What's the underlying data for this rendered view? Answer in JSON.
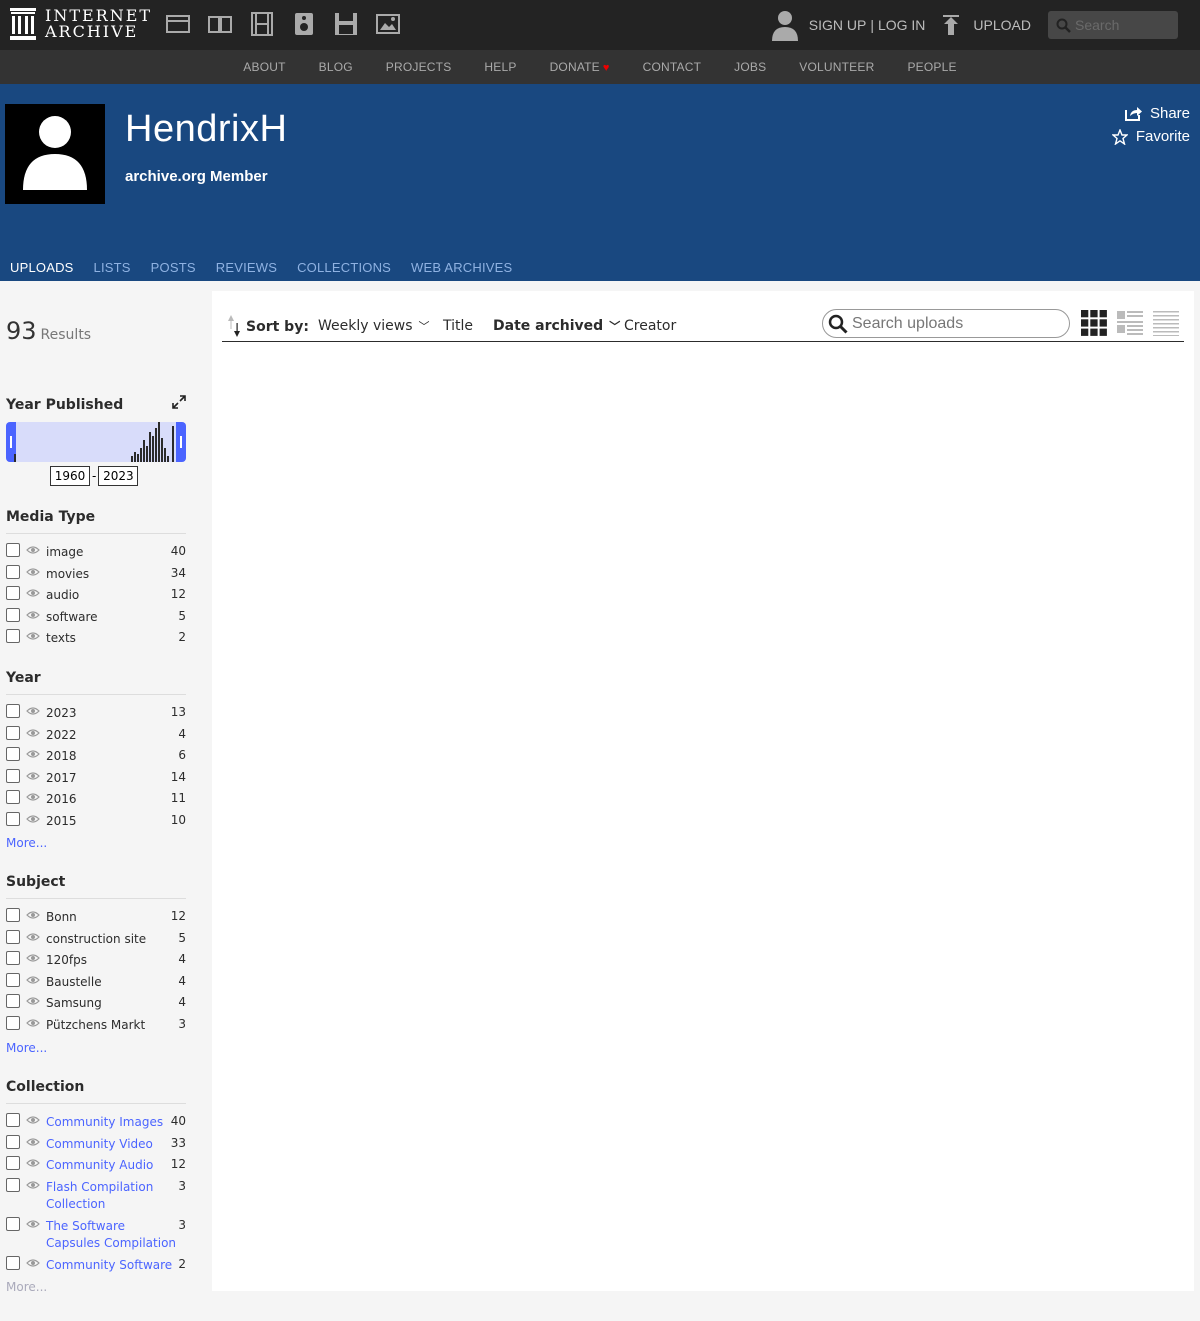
{
  "topnav": {
    "logo_line1": "INTERNET",
    "logo_line2": "ARCHIVE",
    "media_icons": [
      "web-icon",
      "texts-icon",
      "video-icon",
      "audio-icon",
      "software-icon",
      "images-icon"
    ],
    "signup": "SIGN UP",
    "separator": "|",
    "login": "LOG IN",
    "upload": "UPLOAD",
    "search_placeholder": "Search"
  },
  "subnav": {
    "items": [
      "ABOUT",
      "BLOG",
      "PROJECTS",
      "HELP",
      "DONATE",
      "CONTACT",
      "JOBS",
      "VOLUNTEER",
      "PEOPLE"
    ]
  },
  "banner": {
    "name": "HendrixH",
    "role": "archive.org Member",
    "share": "Share",
    "favorite": "Favorite",
    "tabs": [
      "UPLOADS",
      "LISTS",
      "POSTS",
      "REVIEWS",
      "COLLECTIONS",
      "WEB ARCHIVES"
    ],
    "active_tab": "UPLOADS"
  },
  "sidebar": {
    "results_count": "93",
    "results_label": "Results",
    "year_published": {
      "title": "Year Published",
      "from": "1960",
      "to": "2023"
    },
    "media_type": {
      "title": "Media Type",
      "items": [
        {
          "label": "image",
          "count": "40"
        },
        {
          "label": "movies",
          "count": "34"
        },
        {
          "label": "audio",
          "count": "12"
        },
        {
          "label": "software",
          "count": "5"
        },
        {
          "label": "texts",
          "count": "2"
        }
      ]
    },
    "year": {
      "title": "Year",
      "items": [
        {
          "label": "2023",
          "count": "13"
        },
        {
          "label": "2022",
          "count": "4"
        },
        {
          "label": "2018",
          "count": "6"
        },
        {
          "label": "2017",
          "count": "14"
        },
        {
          "label": "2016",
          "count": "11"
        },
        {
          "label": "2015",
          "count": "10"
        }
      ],
      "more": "More..."
    },
    "subject": {
      "title": "Subject",
      "items": [
        {
          "label": "Bonn",
          "count": "12"
        },
        {
          "label": "construction site",
          "count": "5"
        },
        {
          "label": "120fps",
          "count": "4"
        },
        {
          "label": "Baustelle",
          "count": "4"
        },
        {
          "label": "Samsung",
          "count": "4"
        },
        {
          "label": "Pützchens Markt",
          "count": "3"
        }
      ],
      "more": "More..."
    },
    "collection": {
      "title": "Collection",
      "items": [
        {
          "label": "Community Images",
          "count": "40"
        },
        {
          "label": "Community Video",
          "count": "33"
        },
        {
          "label": "Community Audio",
          "count": "12"
        },
        {
          "label": "Flash Compilation Collection",
          "count": "3"
        },
        {
          "label": "The Software Capsules Compilation",
          "count": "3"
        },
        {
          "label": "Community Software",
          "count": "2"
        }
      ],
      "more": "More..."
    }
  },
  "main": {
    "sort_by_label": "Sort by:",
    "sort_options": [
      "Weekly views",
      "Title",
      "Date archived",
      "Creator"
    ],
    "active_sort": "Date archived",
    "search_placeholder": "Search uploads",
    "view_modes": [
      "tile-view-icon",
      "list-detail-view-icon",
      "list-compact-view-icon"
    ]
  },
  "colors": {
    "top_bar": "#232323",
    "sub_bar": "#333333",
    "banner": "#194880",
    "link": "#4b64ff",
    "tab_inactive": "#8fb2e2"
  }
}
